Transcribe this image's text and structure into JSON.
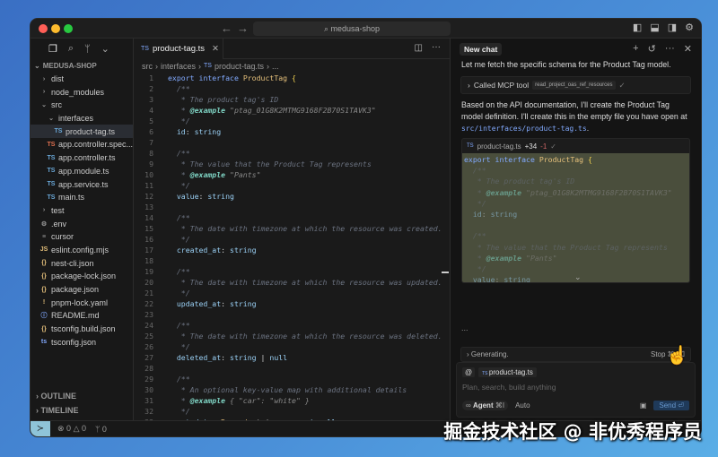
{
  "window": {
    "search": "medusa-shop",
    "traffic": {
      "close": "#ff5f57",
      "min": "#febc2e",
      "max": "#28c840"
    }
  },
  "sidebar": {
    "root": "MEDUSA-SHOP",
    "items": [
      {
        "label": "dist",
        "icon": "chevron-right",
        "depth": 0
      },
      {
        "label": "node_modules",
        "icon": "chevron-right",
        "depth": 0
      },
      {
        "label": "src",
        "icon": "chevron-down",
        "depth": 0
      },
      {
        "label": "interfaces",
        "icon": "chevron-down",
        "depth": 1
      },
      {
        "label": "product-tag.ts",
        "icon": "TS",
        "depth": 2,
        "selected": true
      },
      {
        "label": "app.controller.spec...",
        "icon": "TS",
        "depth": 1,
        "color": "#e07050"
      },
      {
        "label": "app.controller.ts",
        "icon": "TS",
        "depth": 1
      },
      {
        "label": "app.module.ts",
        "icon": "TS",
        "depth": 1
      },
      {
        "label": "app.service.ts",
        "icon": "TS",
        "depth": 1
      },
      {
        "label": "main.ts",
        "icon": "TS",
        "depth": 1
      },
      {
        "label": "test",
        "icon": "chevron-right",
        "depth": 0
      },
      {
        "label": ".env",
        "icon": "⚙",
        "depth": 0
      },
      {
        "label": "cursor",
        "icon": "≡",
        "depth": 0
      },
      {
        "label": "eslint.config.mjs",
        "icon": "JS",
        "depth": 0,
        "color": "#e5c07b"
      },
      {
        "label": "nest-cli.json",
        "icon": "{}",
        "depth": 0,
        "color": "#e5c07b"
      },
      {
        "label": "package-lock.json",
        "icon": "{}",
        "depth": 0,
        "color": "#e5c07b"
      },
      {
        "label": "package.json",
        "icon": "{}",
        "depth": 0,
        "color": "#e5c07b"
      },
      {
        "label": "pnpm-lock.yaml",
        "icon": "!",
        "depth": 0,
        "color": "#e5c07b"
      },
      {
        "label": "README.md",
        "icon": "ⓘ",
        "depth": 0,
        "color": "#82aaff"
      },
      {
        "label": "tsconfig.build.json",
        "icon": "{}",
        "depth": 0,
        "color": "#e5c07b"
      },
      {
        "label": "tsconfig.json",
        "icon": "ts",
        "depth": 0,
        "color": "#82aaff"
      }
    ],
    "outline": "OUTLINE",
    "timeline": "TIMELINE"
  },
  "editor": {
    "tab": "product-tag.ts",
    "breadcrumb": [
      "src",
      "interfaces",
      "product-tag.ts",
      "..."
    ],
    "lines": [
      [
        [
          "export ",
          "kw"
        ],
        [
          "interface ",
          "kw"
        ],
        [
          "ProductTag ",
          "type"
        ],
        [
          "{",
          "b"
        ]
      ],
      [
        [
          "  /**",
          "cm"
        ]
      ],
      [
        [
          "   * The product tag's ID",
          "cm"
        ]
      ],
      [
        [
          "   * ",
          "cm"
        ],
        [
          "@example",
          "tag"
        ],
        [
          " \"ptag_01G8K2MTMG9168F2B70S1TAVK3\"",
          "str"
        ]
      ],
      [
        [
          "   */",
          "cm"
        ]
      ],
      [
        [
          "  id",
          "prop"
        ],
        [
          ": ",
          "p"
        ],
        [
          "string",
          "prop"
        ]
      ],
      [],
      [
        [
          "  /**",
          "cm"
        ]
      ],
      [
        [
          "   * The value that the Product Tag represents",
          "cm"
        ]
      ],
      [
        [
          "   * ",
          "cm"
        ],
        [
          "@example",
          "tag"
        ],
        [
          " \"Pants\"",
          "str"
        ]
      ],
      [
        [
          "   */",
          "cm"
        ]
      ],
      [
        [
          "  value",
          "prop"
        ],
        [
          ": ",
          "p"
        ],
        [
          "string",
          "prop"
        ]
      ],
      [],
      [
        [
          "  /**",
          "cm"
        ]
      ],
      [
        [
          "   * The date with timezone at which the resource was created.",
          "cm"
        ]
      ],
      [
        [
          "   */",
          "cm"
        ]
      ],
      [
        [
          "  created_at",
          "prop"
        ],
        [
          ": ",
          "p"
        ],
        [
          "string",
          "prop"
        ]
      ],
      [],
      [
        [
          "  /**",
          "cm"
        ]
      ],
      [
        [
          "   * The date with timezone at which the resource was updated.",
          "cm"
        ]
      ],
      [
        [
          "   */",
          "cm"
        ]
      ],
      [
        [
          "  updated_at",
          "prop"
        ],
        [
          ": ",
          "p"
        ],
        [
          "string",
          "prop"
        ]
      ],
      [],
      [
        [
          "  /**",
          "cm"
        ]
      ],
      [
        [
          "   * The date with timezone at which the resource was deleted.",
          "cm"
        ]
      ],
      [
        [
          "   */",
          "cm"
        ]
      ],
      [
        [
          "  deleted_at",
          "prop"
        ],
        [
          ": ",
          "p"
        ],
        [
          "string ",
          "prop"
        ],
        [
          "| ",
          "p"
        ],
        [
          "null",
          "prop"
        ]
      ],
      [],
      [
        [
          "  /**",
          "cm"
        ]
      ],
      [
        [
          "   * An optional key-value map with additional details",
          "cm"
        ]
      ],
      [
        [
          "   * ",
          "cm"
        ],
        [
          "@example",
          "tag"
        ],
        [
          " { \"car\": \"white\" }",
          "str"
        ]
      ],
      [
        [
          "   */",
          "cm"
        ]
      ],
      [
        [
          "  metadata",
          "prop"
        ],
        [
          ": ",
          "p"
        ],
        [
          "Record",
          "type"
        ],
        [
          "<string, any> ",
          "p"
        ],
        [
          "| null",
          "prop"
        ]
      ]
    ]
  },
  "chat": {
    "title": "New chat",
    "msg1": "Let me fetch the specific schema for the Product Tag model.",
    "mcp_label": "Called MCP tool",
    "mcp_tool": "read_project_oas_ref_resources",
    "msg2": "Based on the API documentation, I'll create the Product Tag model definition. I'll create this in the empty file you have open at ",
    "msg2_path": "src/interfaces/product-tag.ts",
    "msg2_end": ".",
    "diff": {
      "file": "product-tag.ts",
      "added": "+34",
      "removed": "-1"
    },
    "ellipsis": "...",
    "generating": "Generating.",
    "stop": "Stop ⌘⌫",
    "context_file": "product-tag.ts",
    "placeholder": "Plan, search, build anything",
    "mode": "Agent",
    "mode_shortcut": "⌘I",
    "model": "Auto",
    "send": "Send ⏎"
  },
  "status": {
    "errors": "0",
    "warnings": "0",
    "ports": "0"
  },
  "watermark": "掘金技术社区 @ 非优秀程序员"
}
